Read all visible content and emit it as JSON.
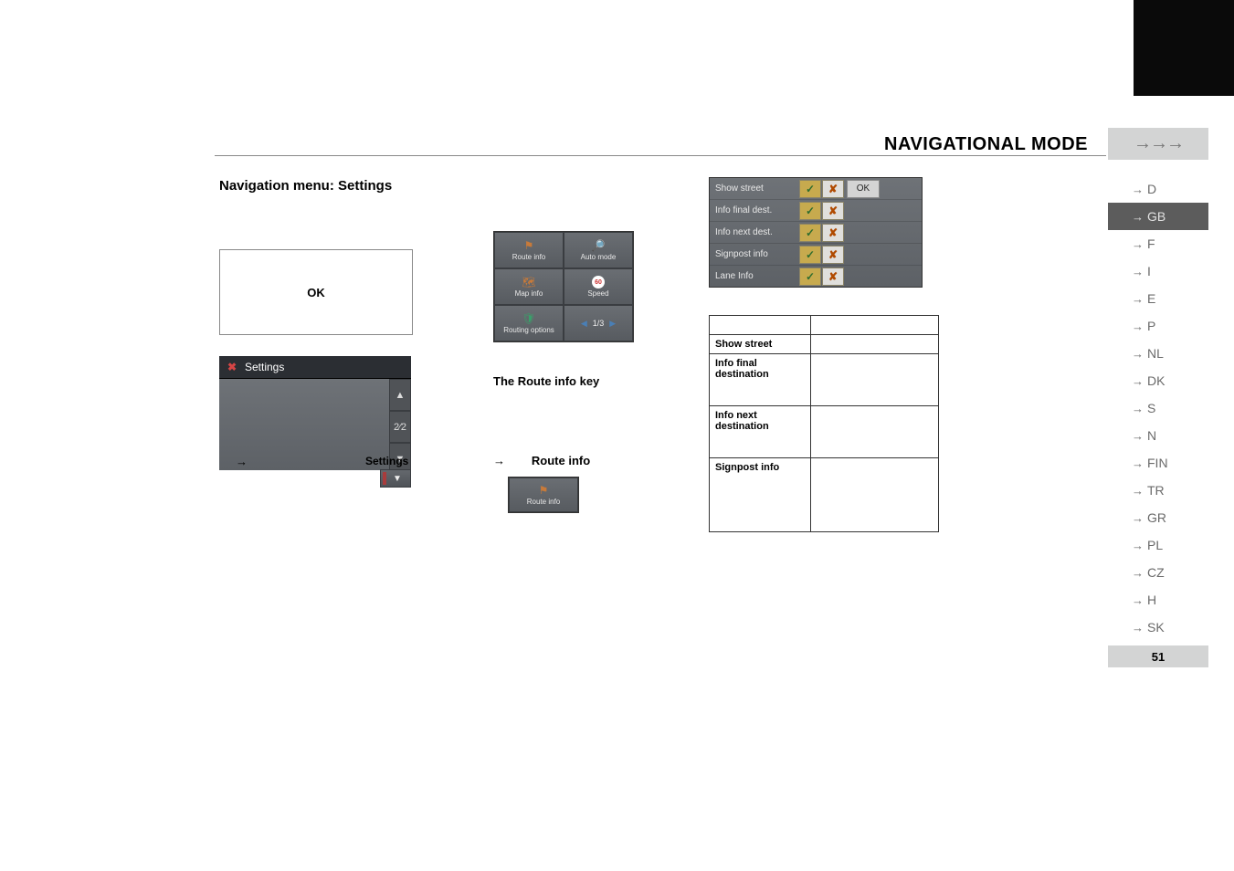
{
  "header": {
    "title": "NAVIGATIONAL MODE",
    "arrows": "→→→"
  },
  "side_index": [
    "D",
    "GB",
    "F",
    "I",
    "E",
    "P",
    "NL",
    "DK",
    "S",
    "N",
    "FIN",
    "TR",
    "GR",
    "PL",
    "CZ",
    "H",
    "SK"
  ],
  "side_active": "GB",
  "page_number": "51",
  "left": {
    "section_title": "Navigation menu: Settings",
    "ok_label": "OK",
    "settings_tab": "Settings",
    "scroll_fraction": "2⁄2",
    "arrow_symbol": "→",
    "settings_word": "Settings",
    "scroll_up": "▲",
    "scroll_down": "▼",
    "down_glyph": "▼"
  },
  "grid": {
    "route_info": "Route info",
    "auto_mode": "Auto mode",
    "map_info": "Map info",
    "speed": "Speed",
    "routing_options": "Routing options",
    "pager_prev": "◀",
    "pager": "1/3",
    "pager_next": "▶"
  },
  "mid": {
    "sub1": "The Route info key",
    "arrow_symbol": "→",
    "sub2": "Route info",
    "tile_label": "Route info"
  },
  "toggles": {
    "rows": [
      "Show street",
      "Info final dest.",
      "Info next dest.",
      "Signpost info",
      "Lane Info"
    ],
    "ok": "OK",
    "tick": "✓",
    "cross": "✘"
  },
  "info_table": {
    "rows": [
      "Show street",
      "Info final destination",
      "Info next destination",
      "Signpost info"
    ]
  }
}
